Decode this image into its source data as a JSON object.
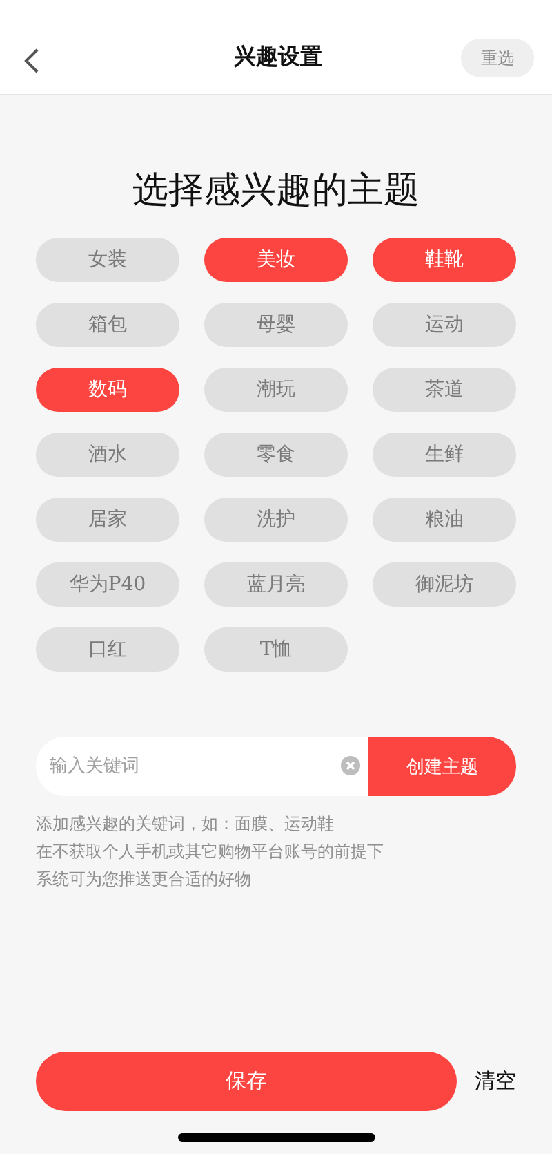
{
  "header": {
    "title": "兴趣设置",
    "reset_button": "重选"
  },
  "heading": "选择感兴趣的主题",
  "tags": [
    {
      "label": "女装",
      "selected": false
    },
    {
      "label": "美妆",
      "selected": true
    },
    {
      "label": "鞋靴",
      "selected": true
    },
    {
      "label": "箱包",
      "selected": false
    },
    {
      "label": "母婴",
      "selected": false
    },
    {
      "label": "运动",
      "selected": false
    },
    {
      "label": "数码",
      "selected": true
    },
    {
      "label": "潮玩",
      "selected": false
    },
    {
      "label": "茶道",
      "selected": false
    },
    {
      "label": "酒水",
      "selected": false
    },
    {
      "label": "零食",
      "selected": false
    },
    {
      "label": "生鲜",
      "selected": false
    },
    {
      "label": "居家",
      "selected": false
    },
    {
      "label": "洗护",
      "selected": false
    },
    {
      "label": "粮油",
      "selected": false
    },
    {
      "label": "华为P40",
      "selected": false
    },
    {
      "label": "蓝月亮",
      "selected": false
    },
    {
      "label": "御泥坊",
      "selected": false
    },
    {
      "label": "口红",
      "selected": false
    },
    {
      "label": "T恤",
      "selected": false
    }
  ],
  "keyword": {
    "placeholder": "输入关键词",
    "create_button": "创建主题"
  },
  "hints": [
    "添加感兴趣的关键词，如：面膜、运动鞋",
    "在不获取个人手机或其它购物平台账号的前提下",
    "系统可为您推送更合适的好物"
  ],
  "footer": {
    "save_button": "保存",
    "clear_button": "清空"
  }
}
